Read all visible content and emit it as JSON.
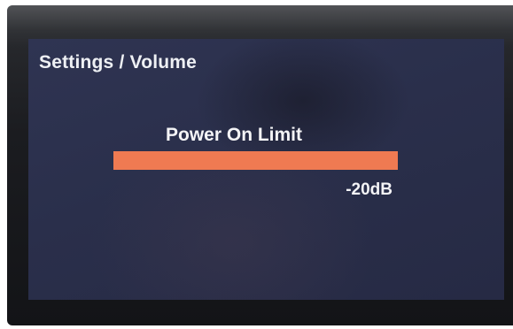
{
  "breadcrumb": "Settings / Volume",
  "setting": {
    "label": "Power On Limit",
    "value_text": "-20dB",
    "level_fraction": 1.0
  },
  "colors": {
    "screen_background": "#2a2f4b",
    "bar_fill": "#ef7a52",
    "text": "#f2f2f2"
  }
}
